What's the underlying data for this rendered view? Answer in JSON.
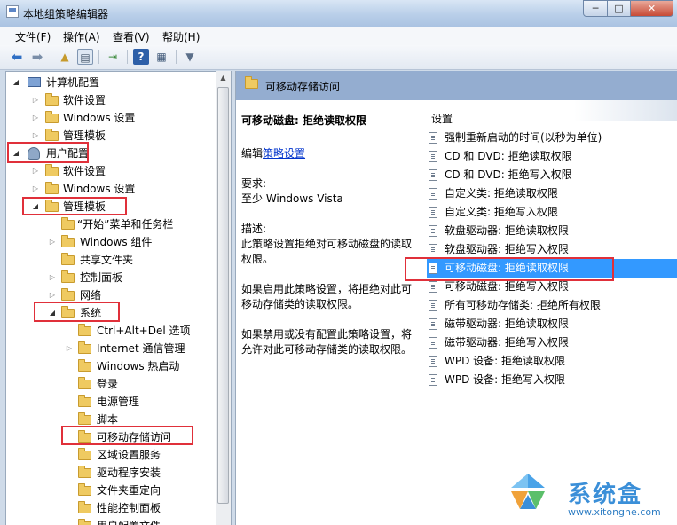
{
  "window": {
    "title": "本地组策略编辑器",
    "min": "─",
    "max": "□",
    "close": "✕"
  },
  "menu": [
    "文件(F)",
    "操作(A)",
    "查看(V)",
    "帮助(H)"
  ],
  "tree": {
    "computer": {
      "label": "计算机配置",
      "children": [
        "软件设置",
        "Windows 设置",
        "管理模板"
      ]
    },
    "user": {
      "label": "用户配置",
      "software": "软件设置",
      "windows": "Windows 设置",
      "admin": "管理模板"
    },
    "admin_children": [
      "“开始”菜单和任务栏",
      "Windows 组件",
      "共享文件夹",
      "控制面板",
      "网络"
    ],
    "system": "系统",
    "system_children": [
      "Ctrl+Alt+Del 选项",
      "Internet 通信管理",
      "Windows 热启动",
      "登录",
      "电源管理",
      "脚本",
      "可移动存储访问",
      "区域设置服务",
      "驱动程序安装",
      "文件夹重定向",
      "性能控制面板",
      "用户配置文件"
    ]
  },
  "right": {
    "header": "可移动存储访问",
    "policy_title": "可移动磁盘: 拒绝读取权限",
    "edit_prefix": "编辑",
    "edit_link": "策略设置",
    "req_label": "要求:",
    "req_value": "至少 Windows Vista",
    "desc_label": "描述:",
    "desc_1": "此策略设置拒绝对可移动磁盘的读取权限。",
    "desc_2": "如果启用此策略设置，将拒绝对此可移动存储类的读取权限。",
    "desc_3": "如果禁用或没有配置此策略设置，将允许对此可移动存储类的读取权限。",
    "settings_header": "设置",
    "settings": [
      "强制重新启动的时间(以秒为单位)",
      "CD 和 DVD: 拒绝读取权限",
      "CD 和 DVD: 拒绝写入权限",
      "自定义类: 拒绝读取权限",
      "自定义类: 拒绝写入权限",
      "软盘驱动器: 拒绝读取权限",
      "软盘驱动器: 拒绝写入权限",
      "可移动磁盘: 拒绝读取权限",
      "可移动磁盘: 拒绝写入权限",
      "所有可移动存储类: 拒绝所有权限",
      "磁带驱动器: 拒绝读取权限",
      "磁带驱动器: 拒绝写入权限",
      "WPD 设备: 拒绝读取权限",
      "WPD 设备: 拒绝写入权限"
    ],
    "selected_index": 7
  },
  "watermark": {
    "name": "系统盒",
    "url": "www.xitonghe.com"
  },
  "colors": {
    "selection": "#3399ff",
    "annotation": "#e0303a",
    "header": "#94add0"
  }
}
